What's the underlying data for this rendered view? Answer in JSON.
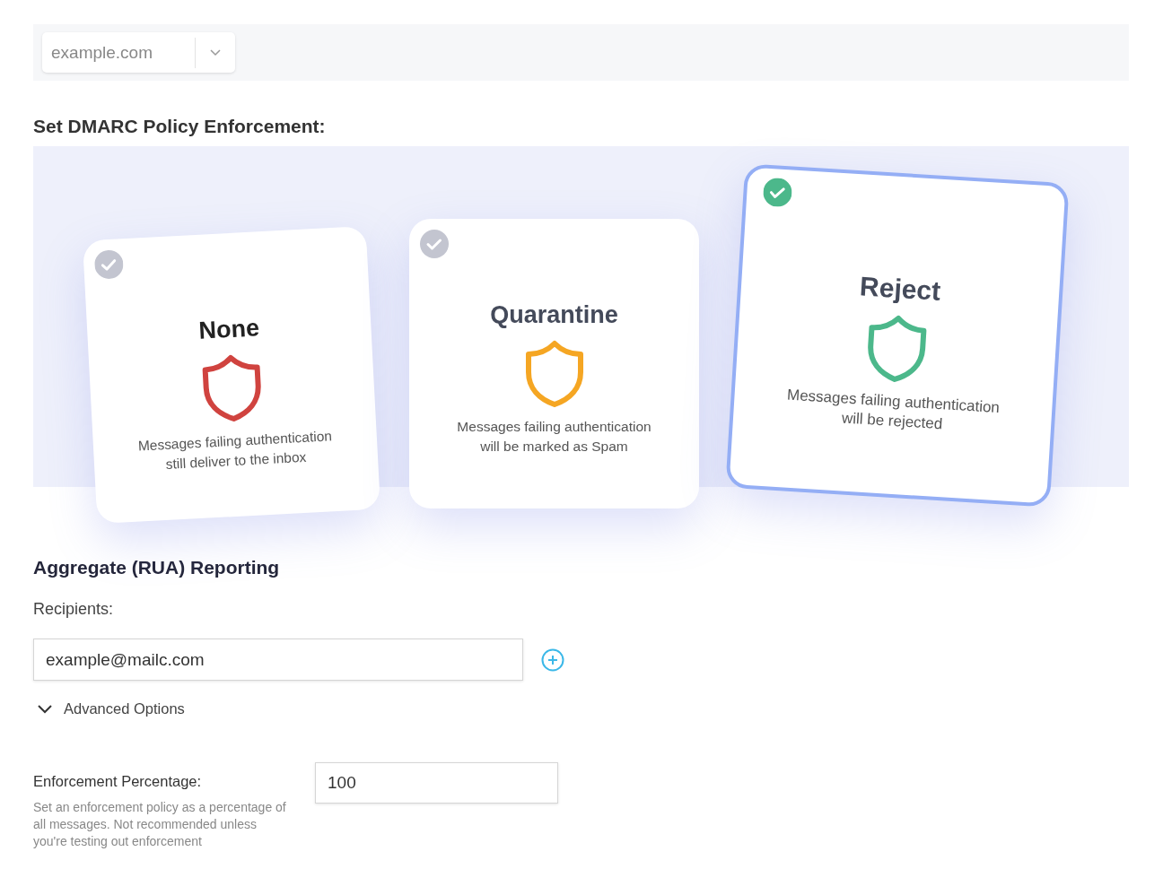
{
  "domain_select": {
    "value": "example.com"
  },
  "policy_heading": "Set DMARC Policy Enforcement:",
  "policies": [
    {
      "title": "None",
      "description": "Messages failing authentication still deliver to the inbox",
      "color": "#d0433f",
      "selected": false
    },
    {
      "title": "Quarantine",
      "description": "Messages failing authentication will be marked as Spam",
      "color": "#f5a623",
      "selected": false
    },
    {
      "title": "Reject",
      "description": "Messages failing authentication will be rejected",
      "color": "#4cb88b",
      "selected": true
    }
  ],
  "reporting": {
    "heading": "Aggregate (RUA) Reporting",
    "recipients_label": "Recipients:",
    "recipient": "example@mailc.com",
    "advanced_options": {
      "label": "Advanced Options",
      "expanded": true
    }
  },
  "enforcement": {
    "label": "Enforcement Percentage:",
    "help": "Set an enforcement policy as a percentage of all messages. Not recommended unless you're testing out enforcement",
    "value": "100"
  }
}
